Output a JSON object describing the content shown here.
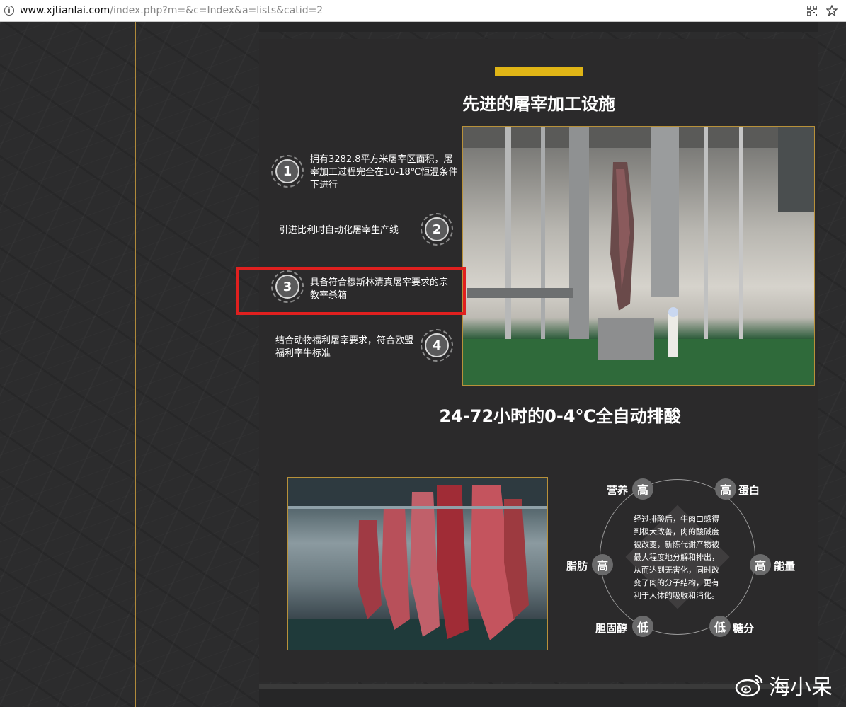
{
  "browser": {
    "url_host": "www.xjtianlai.com",
    "url_path": "/index.php?m=&c=Index&a=lists&catid=2"
  },
  "section1": {
    "title": "先进的屠宰加工设施",
    "items": [
      {
        "num": "1",
        "text": "拥有3282.8平方米屠宰区面积，屠宰加工过程完全在10-18℃恒温条件下进行"
      },
      {
        "num": "2",
        "text": "引进比利时自动化屠宰生产线"
      },
      {
        "num": "3",
        "text": "具备符合穆斯林清真屠宰要求的宗教宰杀箱"
      },
      {
        "num": "4",
        "text": "结合动物福利屠宰要求，符合欧盟福利宰牛标准"
      }
    ]
  },
  "section2": {
    "title": "24-72小时的0-4℃全自动排酸",
    "center_text": "经过排酸后，牛肉口感得到极大改善，肉的酸碱度被改变，新陈代谢产物被最大程度地分解和排出，从而达到无害化，同时改变了肉的分子结构，更有利于人体的吸收和消化。",
    "nutrients": [
      {
        "label": "营养",
        "level": "高"
      },
      {
        "label": "蛋白",
        "level": "高"
      },
      {
        "label": "脂肪",
        "level": "高"
      },
      {
        "label": "能量",
        "level": "高"
      },
      {
        "label": "胆固醇",
        "level": "低"
      },
      {
        "label": "糖分",
        "level": "低"
      }
    ]
  },
  "watermark": "海小呆",
  "colors": {
    "accent": "#e0b516",
    "highlight": "#e0201f",
    "photo_border": "#b8913a"
  }
}
